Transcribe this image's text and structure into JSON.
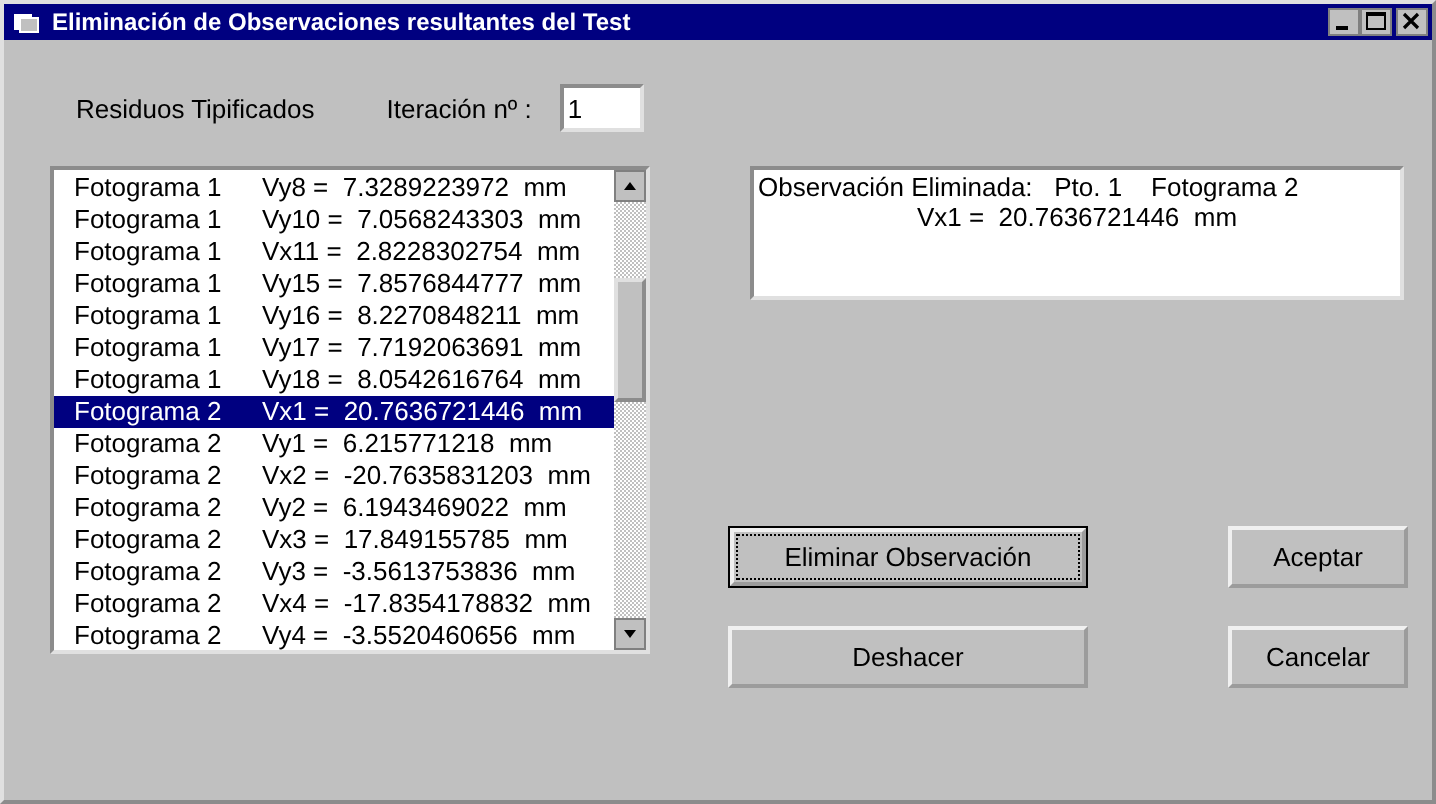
{
  "window": {
    "title": "Eliminación de Observaciones resultantes del Test"
  },
  "residuals_label": "Residuos Tipificados",
  "iteration": {
    "label": "Iteración nº :",
    "value": "1"
  },
  "residuals": [
    {
      "photo": "Fotograma 1",
      "value": "Vy8 =  7.3289223972  mm",
      "selected": false
    },
    {
      "photo": "Fotograma 1",
      "value": "Vy10 =  7.0568243303  mm",
      "selected": false
    },
    {
      "photo": "Fotograma 1",
      "value": "Vx11 =  2.8228302754  mm",
      "selected": false
    },
    {
      "photo": "Fotograma 1",
      "value": "Vy15 =  7.8576844777  mm",
      "selected": false
    },
    {
      "photo": "Fotograma 1",
      "value": "Vy16 =  8.2270848211  mm",
      "selected": false
    },
    {
      "photo": "Fotograma 1",
      "value": "Vy17 =  7.7192063691  mm",
      "selected": false
    },
    {
      "photo": "Fotograma 1",
      "value": "Vy18 =  8.0542616764  mm",
      "selected": false
    },
    {
      "photo": "Fotograma 2",
      "value": "Vx1 =  20.7636721446  mm",
      "selected": true
    },
    {
      "photo": "Fotograma 2",
      "value": "Vy1 =  6.215771218  mm",
      "selected": false
    },
    {
      "photo": "Fotograma 2",
      "value": "Vx2 =  -20.7635831203  mm",
      "selected": false
    },
    {
      "photo": "Fotograma 2",
      "value": "Vy2 =  6.1943469022  mm",
      "selected": false
    },
    {
      "photo": "Fotograma 2",
      "value": "Vx3 =  17.849155785  mm",
      "selected": false
    },
    {
      "photo": "Fotograma 2",
      "value": "Vy3 =  -3.5613753836  mm",
      "selected": false
    },
    {
      "photo": "Fotograma 2",
      "value": "Vx4 =  -17.8354178832  mm",
      "selected": false
    },
    {
      "photo": "Fotograma 2",
      "value": "Vy4 =  -3.5520460656  mm",
      "selected": false
    }
  ],
  "eliminated": [
    "Observación Eliminada:   Pto. 1    Fotograma 2",
    "Vx1 =  20.7636721446  mm"
  ],
  "buttons": [
    {
      "label": "Eliminar Observación",
      "focused": true
    },
    {
      "label": "Aceptar",
      "focused": false
    },
    {
      "label": "Deshacer",
      "focused": false
    },
    {
      "label": "Cancelar",
      "focused": false
    }
  ]
}
